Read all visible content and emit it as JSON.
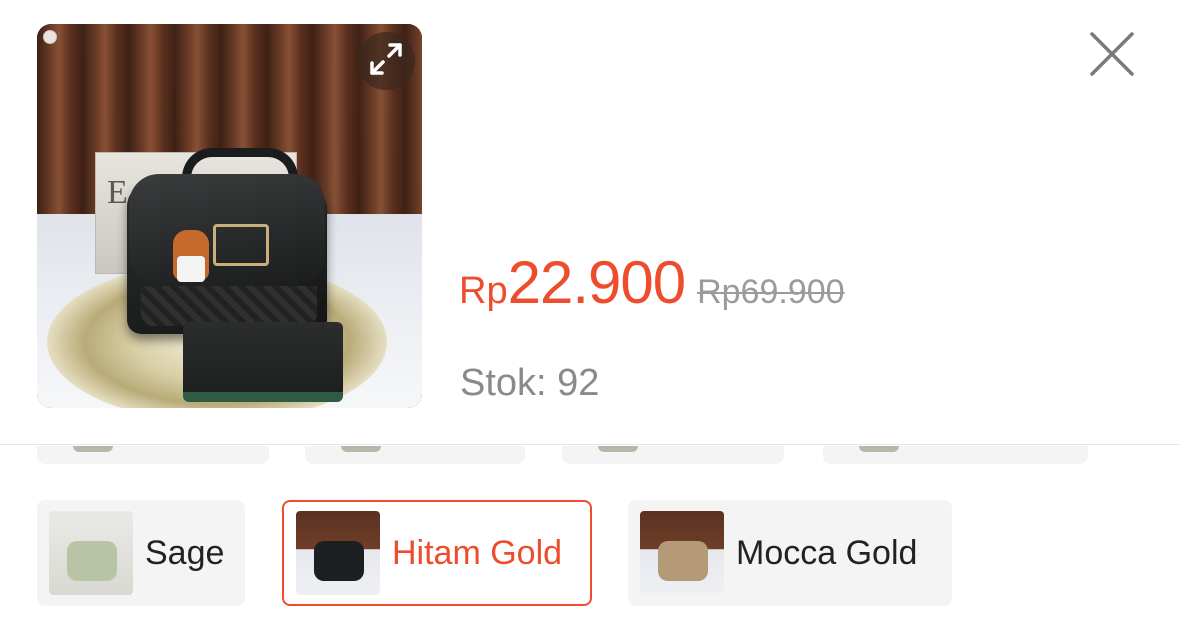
{
  "product": {
    "image_alt": "black handbag with bear keychain",
    "book_text": "E L I",
    "price_currency": "Rp",
    "price_value": "22.900",
    "original_price": "Rp69.900",
    "stock_text": "Stok: 92"
  },
  "icons": {
    "expand": "expand-icon",
    "close": "close-icon"
  },
  "variants": [
    {
      "label": "Sage",
      "selected": false
    },
    {
      "label": "Hitam Gold",
      "selected": true
    },
    {
      "label": "Mocca Gold",
      "selected": false
    }
  ],
  "colors": {
    "accent": "#ee4d2d",
    "muted_text": "#8a8a8a",
    "chip_bg": "#f4f4f4"
  }
}
